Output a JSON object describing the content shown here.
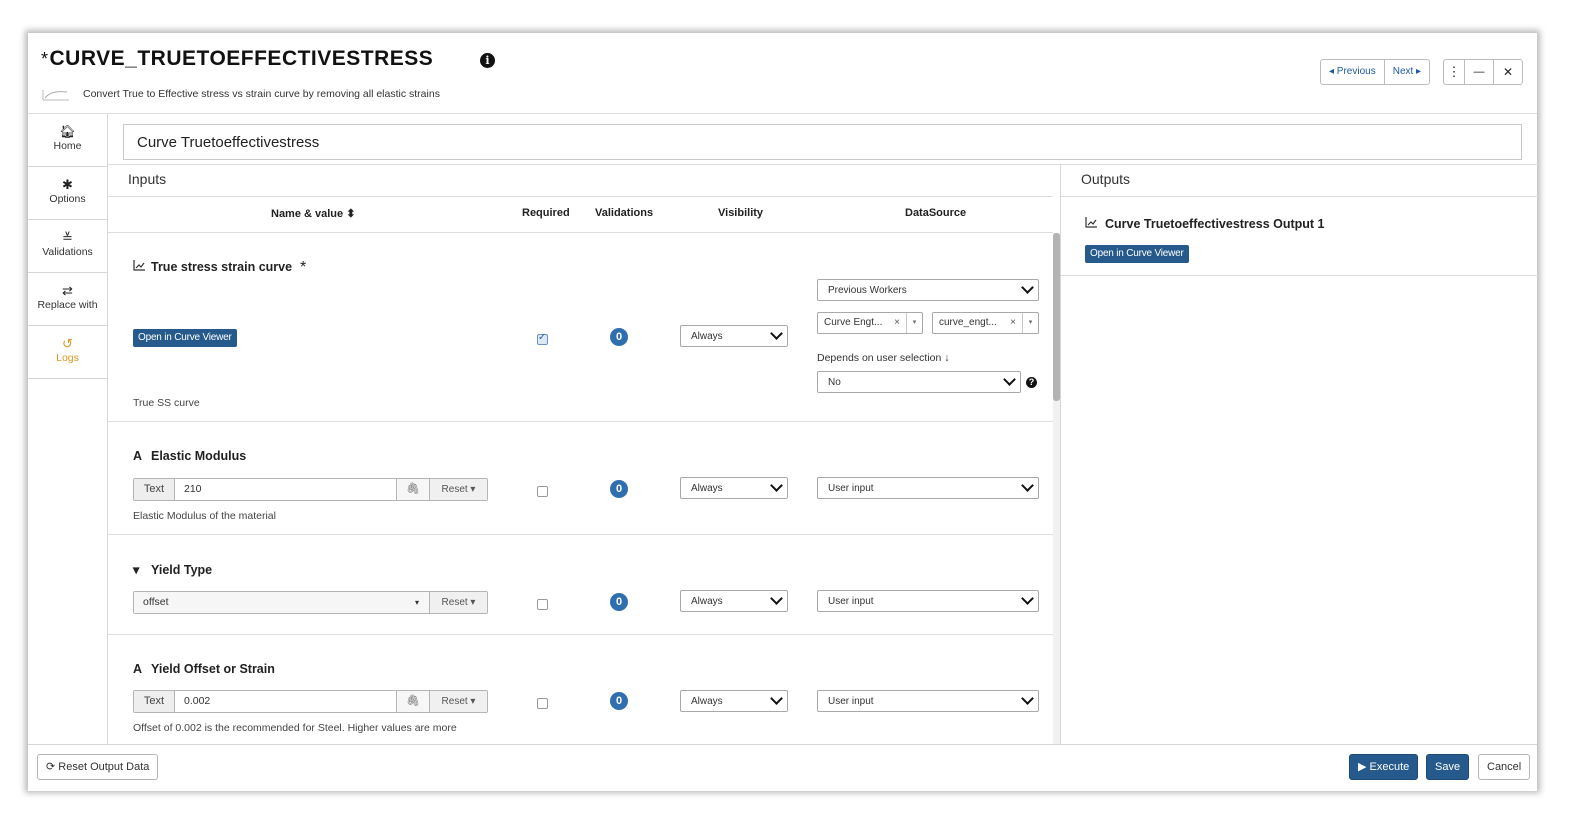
{
  "header": {
    "title_prefix": "*",
    "title": "CURVE_TRUETOEFFECTIVESTRESS",
    "info_icon": "info-icon",
    "description": "Convert True to Effective stress vs strain curve by removing all elastic strains",
    "prev_label": "◂ Previous",
    "next_label": "Next ▸",
    "menu_glyph": "⋮",
    "minimize_glyph": "—",
    "close_glyph": "✕"
  },
  "sidebar": {
    "items": [
      {
        "label": "Home",
        "icon": "home-icon",
        "glyph": "🏠︎"
      },
      {
        "label": "Options",
        "icon": "gear-icon",
        "glyph": "✱"
      },
      {
        "label": "Validations",
        "icon": "double-check-icon",
        "glyph": "≚"
      },
      {
        "label": "Replace with",
        "icon": "swap-icon",
        "glyph": "⇄"
      },
      {
        "label": "Logs",
        "icon": "history-icon",
        "glyph": "↺"
      }
    ],
    "active": "Logs"
  },
  "name_field": {
    "value": "Curve Truetoeffectivestress"
  },
  "inputs": {
    "title": "Inputs",
    "columns": {
      "name": "Name & value ⬍",
      "required": "Required",
      "validations": "Validations",
      "visibility": "Visibility",
      "datasource": "DataSource"
    },
    "rows": [
      {
        "title": "True stress strain curve",
        "icon": "chart-line-icon",
        "required_star": "*",
        "button": "Open in Curve Viewer",
        "description": "True SS curve",
        "required": true,
        "validations": "0",
        "visibility": "Always",
        "datasource": "Previous Workers",
        "tag1": "Curve Engt...",
        "tag2": "curve_engt...",
        "tag_remove": "×",
        "tag_caret": "▾",
        "depends_label": "Depends on user selection ↓",
        "depends_value": "No",
        "help": "?"
      },
      {
        "title": "Elastic Modulus",
        "icon": "text-type-icon",
        "type_glyph": "A",
        "addon": "Text",
        "value": "210",
        "clip": "🖇",
        "reset": "Reset ▾",
        "description": "Elastic Modulus of the material",
        "required": false,
        "validations": "0",
        "visibility": "Always",
        "datasource": "User input"
      },
      {
        "title": "Yield Type",
        "icon": "caret-down-icon",
        "type_glyph": "▾",
        "value": "offset",
        "select_caret": "▾",
        "reset": "Reset ▾",
        "required": false,
        "validations": "0",
        "visibility": "Always",
        "datasource": "User input"
      },
      {
        "title": "Yield Offset or Strain",
        "icon": "text-type-icon",
        "type_glyph": "A",
        "addon": "Text",
        "value": "0.002",
        "clip": "🖇",
        "reset": "Reset ▾",
        "description": "Offset of 0.002 is the recommended for Steel. Higher values are more",
        "required": false,
        "validations": "0",
        "visibility": "Always",
        "datasource": "User input"
      }
    ]
  },
  "outputs": {
    "title": "Outputs",
    "item_title": "Curve Truetoeffectivestress Output 1",
    "button": "Open in Curve Viewer"
  },
  "footer": {
    "reset_output": "⟳ Reset Output Data",
    "execute": "▶ Execute",
    "save": "Save",
    "cancel": "Cancel"
  },
  "colors": {
    "primary": "#265a8c",
    "badge": "#2f6fb0",
    "active_tab": "#e0961b"
  }
}
